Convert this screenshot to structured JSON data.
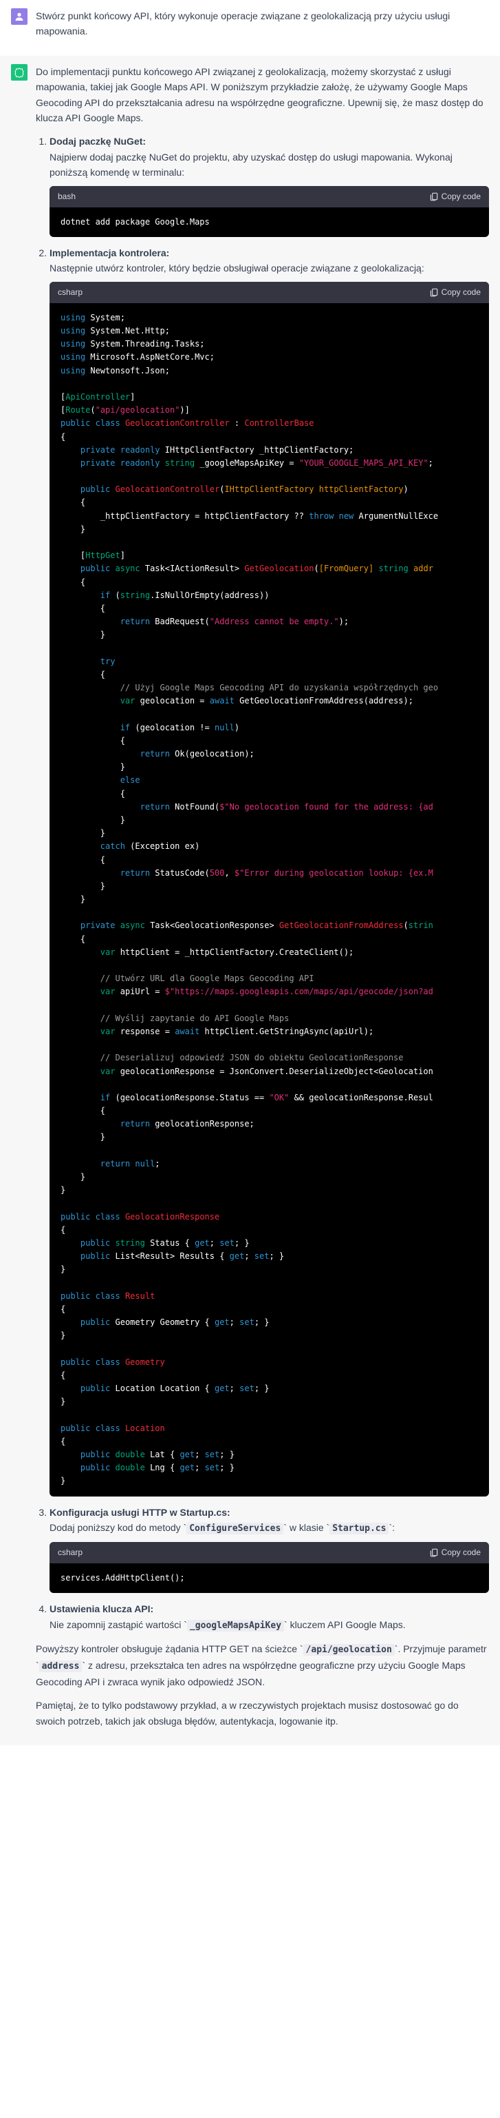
{
  "user": {
    "text": "Stwórz punkt końcowy API, który wykonuje operacje związane z geolokalizacją przy użyciu usługi mapowania."
  },
  "assistant": {
    "intro": "Do implementacji punktu końcowego API związanej z geolokalizacją, możemy skorzystać z usługi mapowania, takiej jak Google Maps API. W poniższym przykładzie założę, że używamy Google Maps Geocoding API do przekształcania adresu na współrzędne geograficzne. Upewnij się, że masz dostęp do klucza API Google Maps.",
    "steps": [
      {
        "title": "Dodaj paczkę NuGet:",
        "desc": "Najpierw dodaj paczkę NuGet do projektu, aby uzyskać dostęp do usługi mapowania. Wykonaj poniższą komendę w terminalu:",
        "code_lang": "bash",
        "code": "dotnet add package Google.Maps"
      },
      {
        "title": "Implementacja kontrolera:",
        "desc": "Następnie utwórz kontroler, który będzie obsługiwał operacje związane z geolokalizacją:",
        "code_lang": "csharp"
      },
      {
        "title": "Konfiguracja usługi HTTP w Startup.cs:",
        "desc_parts": [
          "Dodaj poniższy kod do metody `",
          "ConfigureServices",
          "` w klasie `",
          "Startup.cs",
          "`:"
        ],
        "code_lang": "csharp",
        "code": "services.AddHttpClient();"
      },
      {
        "title": "Ustawienia klucza API:",
        "desc_parts": [
          "Nie zapomnij zastąpić wartości `",
          "_googleMapsApiKey",
          "` kluczem API Google Maps."
        ]
      }
    ],
    "outro1_parts": [
      "Powyższy kontroler obsługuje żądania HTTP GET na ścieżce `",
      "/api/geolocation",
      "`. Przyjmuje parametr `",
      "address",
      "` z adresu, przekształca ten adres na współrzędne geograficzne przy użyciu Google Maps Geocoding API i zwraca wynik jako odpowiedź JSON."
    ],
    "outro2": "Pamiętaj, że to tylko podstawowy przykład, a w rzeczywistych projektach musisz dostosować go do swoich potrzeb, takich jak obsługa błędów, autentykacja, logowanie itp."
  },
  "copy_label": "Copy code",
  "csharp_code": {
    "usings": [
      "System",
      "System.Net.Http",
      "System.Threading.Tasks",
      "Microsoft.AspNetCore.Mvc",
      "Newtonsoft.Json"
    ],
    "route": "api/geolocation",
    "controller_name": "GeolocationController",
    "base_class": "ControllerBase",
    "api_key_value": "YOUR_GOOGLE_MAPS_API_KEY",
    "factory_field": "_httpClientFactory",
    "api_key_field": "_googleMapsApiKey",
    "empty_err": "Address cannot be empty.",
    "comment_geocode": "// Użyj Google Maps Geocoding API do uzyskania współrzędnych geo",
    "notfound_msg": "No geolocation found for the address: {ad",
    "error_msg": "Error during geolocation lookup: {ex.M",
    "method_name": "GetGeolocation",
    "from_address_method": "GetGeolocationFromAddress",
    "comment_url": "// Utwórz URL dla Google Maps Geocoding API",
    "api_url": "https://maps.googleapis.com/maps/api/geocode/json?ad",
    "comment_query": "// Wyślij zapytanie do API Google Maps",
    "comment_deserialize": "// Deserializuj odpowiedź JSON do obiektu GeolocationResponse",
    "status_ok": "OK",
    "classes": {
      "resp": "GeolocationResponse",
      "result": "Result",
      "geometry": "Geometry",
      "location": "Location"
    },
    "props": {
      "status": "Status",
      "results": "Results",
      "geometry": "Geometry",
      "location": "Location",
      "lat": "Lat",
      "lng": "Lng"
    }
  }
}
